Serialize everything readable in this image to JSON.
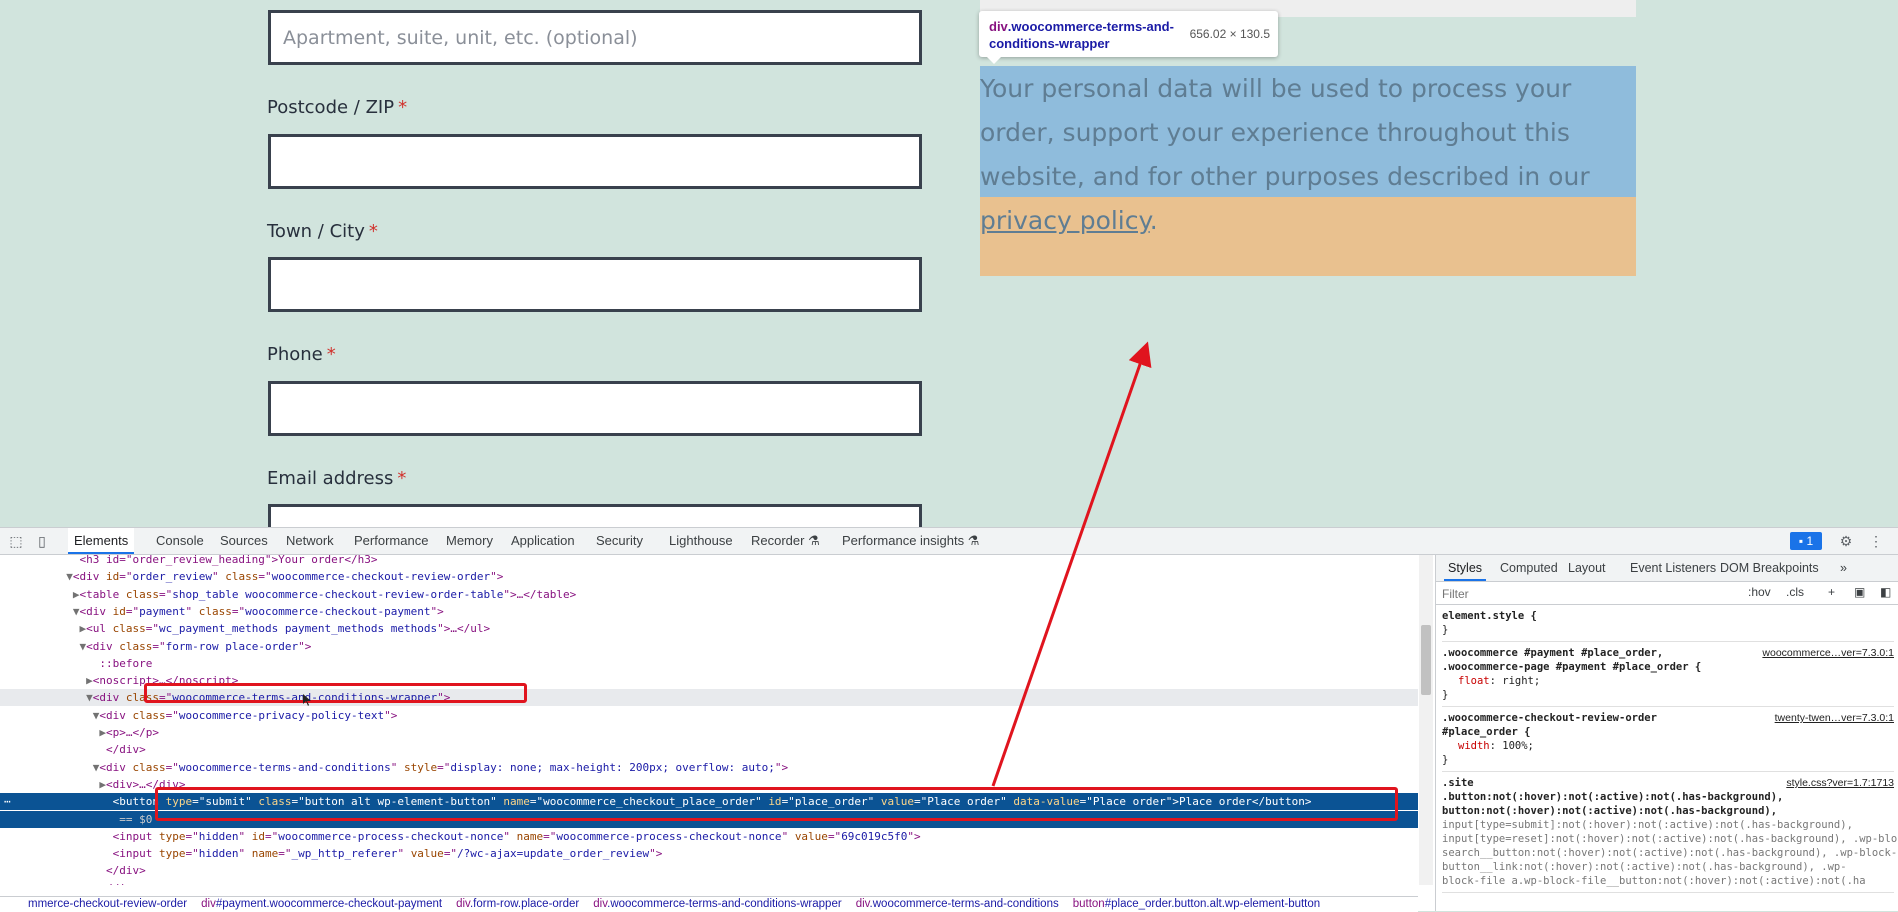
{
  "form": {
    "address2_placeholder": "Apartment, suite, unit, etc. (optional)",
    "postcode_label": "Postcode / ZIP",
    "town_label": "Town / City",
    "phone_label": "Phone",
    "email_label": "Email address",
    "required_mark": "*"
  },
  "inspector_tooltip": {
    "element": "div",
    "class_name": ".woocommerce-terms-and-conditions-wrapper",
    "size": "656.02 × 130.5"
  },
  "privacy": {
    "text": "Your personal data will be used to process your order, support your experience throughout this website, and for other purposes described in our ",
    "link": "privacy policy",
    "end": "."
  },
  "devtools": {
    "tabs": [
      "Elements",
      "Console",
      "Sources",
      "Network",
      "Performance",
      "Memory",
      "Application",
      "Security",
      "Lighthouse",
      "Recorder ⚗",
      "Performance insights ⚗"
    ],
    "issues_count": "1",
    "dom": [
      {
        "indent": 11,
        "tri": "",
        "html": "<h3 id=\"order_review_heading\">Your order</h3>"
      },
      {
        "indent": 10,
        "tri": "▼",
        "tag": "div",
        "attrs": [
          [
            "id",
            "order_review"
          ],
          [
            "class",
            "woocommerce-checkout-review-order"
          ]
        ],
        "close": ">"
      },
      {
        "indent": 11,
        "tri": "▶",
        "tag": "table",
        "attrs": [
          [
            "class",
            "shop_table woocommerce-checkout-review-order-table"
          ]
        ],
        "close": ">…</table>"
      },
      {
        "indent": 11,
        "tri": "▼",
        "tag": "div",
        "attrs": [
          [
            "id",
            "payment"
          ],
          [
            "class",
            "woocommerce-checkout-payment"
          ]
        ],
        "close": ">"
      },
      {
        "indent": 12,
        "tri": "▶",
        "tag": "ul",
        "attrs": [
          [
            "class",
            "wc_payment_methods payment_methods methods"
          ]
        ],
        "close": ">…</ul>"
      },
      {
        "indent": 12,
        "tri": "▼",
        "tag": "div",
        "attrs": [
          [
            "class",
            "form-row place-order"
          ]
        ],
        "close": ">"
      },
      {
        "indent": 14,
        "tri": "",
        "pseudo": "::before"
      },
      {
        "indent": 13,
        "tri": "▶",
        "tag": "noscript",
        "attrs": [],
        "close": ">…</noscript>"
      },
      {
        "indent": 13,
        "tri": "▼",
        "tag": "div",
        "attrs": [
          [
            "class",
            "woocommerce-terms-and-conditions-wrapper"
          ]
        ],
        "close": ">"
      },
      {
        "indent": 14,
        "tri": "▼",
        "tag": "div",
        "attrs": [
          [
            "class",
            "woocommerce-privacy-policy-text"
          ]
        ],
        "close": ">"
      },
      {
        "indent": 15,
        "tri": "▶",
        "tag": "p",
        "attrs": [],
        "close": ">…</p>"
      },
      {
        "indent": 15,
        "tri": "",
        "html": "</div>"
      },
      {
        "indent": 14,
        "tri": "▼",
        "tag": "div",
        "attrs": [
          [
            "class",
            "woocommerce-terms-and-conditions"
          ],
          [
            "style",
            "display: none; max-height: 200px; overflow: auto;"
          ]
        ],
        "close": ">"
      },
      {
        "indent": 15,
        "tri": "▶",
        "tag": "div",
        "attrs": [],
        "close": ">…</div>"
      },
      {
        "indent": 16,
        "tri": "",
        "tag": "button",
        "attrs": [
          [
            "type",
            "submit"
          ],
          [
            "class",
            "button alt wp-element-button"
          ],
          [
            "name",
            "woocommerce_checkout_place_order"
          ],
          [
            "id",
            "place_order"
          ],
          [
            "value",
            "Place order"
          ],
          [
            "data-value",
            "Place order"
          ]
        ],
        "close": ">",
        "text": "Place order",
        "end": "</button>"
      },
      {
        "indent": 17,
        "tri": "",
        "dollar": "== $0"
      },
      {
        "indent": 16,
        "tri": "",
        "tag": "input",
        "attrs": [
          [
            "type",
            "hidden"
          ],
          [
            "id",
            "woocommerce-process-checkout-nonce"
          ],
          [
            "name",
            "woocommerce-process-checkout-nonce"
          ],
          [
            "value",
            "69c019c5f0"
          ]
        ],
        "close": ">"
      },
      {
        "indent": 16,
        "tri": "",
        "tag": "input",
        "attrs": [
          [
            "type",
            "hidden"
          ],
          [
            "name",
            "_wp_http_referer"
          ],
          [
            "value",
            "/?wc-ajax=update_order_review"
          ]
        ],
        "close": ">"
      },
      {
        "indent": 15,
        "tri": "",
        "html": "</div>"
      },
      {
        "indent": 14,
        "tri": "",
        "html": "</div>"
      }
    ],
    "breadcrumbs": [
      {
        "tag": "",
        "rest": "mmerce-checkout-review-order"
      },
      {
        "tag": "div",
        "rest": "#payment.woocommerce-checkout-payment"
      },
      {
        "tag": "div",
        "rest": ".form-row.place-order"
      },
      {
        "tag": "div",
        "rest": ".woocommerce-terms-and-conditions-wrapper"
      },
      {
        "tag": "div",
        "rest": ".woocommerce-terms-and-conditions"
      },
      {
        "tag": "button",
        "rest": "#place_order.button.alt.wp-element-button"
      }
    ],
    "styles_tabs": [
      "Styles",
      "Computed",
      "Layout",
      "Event Listeners",
      "DOM Breakpoints",
      "»"
    ],
    "filter_placeholder": "Filter",
    "filter_buttons": [
      ":hov",
      ".cls",
      "+"
    ],
    "rules": [
      {
        "selector": "element.style {",
        "props": [],
        "close": "}",
        "src": ""
      },
      {
        "selector": ".woocommerce #payment #place_order,\n.woocommerce-page #payment #place_order {",
        "props": [
          [
            "float",
            "right;"
          ]
        ],
        "close": "}",
        "src": "woocommerce…ver=7.3.0:1"
      },
      {
        "selector": ".woocommerce-checkout-review-order\n#place_order {",
        "props": [
          [
            "width",
            "100%;"
          ]
        ],
        "close": "}",
        "src": "twenty-twen…ver=7.3.0:1"
      },
      {
        "selector": ".site\n.button:not(:hover):not(:active):not(.has-background),\nbutton:not(:hover):not(:active):not(.has-background),",
        "dim": "input[type=submit]:not(:hover):not(:active):not(.has-background),\ninput[type=reset]:not(:hover):not(:active):not(.has-background), .wp-block-search .wp-block-\nsearch__button:not(:hover):not(:active):not(.has-background), .wp-block-button .wp-block-\nbutton__link:not(:hover):not(:active):not(.has-background), .wp-\nblock-file a.wp-block-file__button:not(:hover):not(:active):not(.ha",
        "props": [],
        "close": "",
        "src": "style.css?ver=1.7:1713"
      }
    ]
  }
}
